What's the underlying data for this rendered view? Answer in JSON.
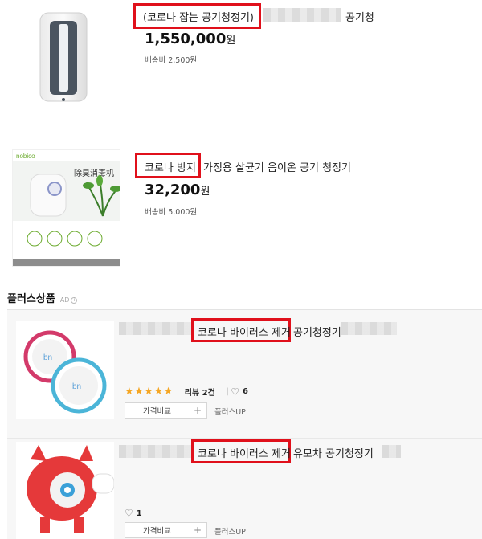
{
  "products": [
    {
      "title_highlight": "(코로나 잡는 공기청정기)",
      "title_suffix": "공기청",
      "price": "1,550,000",
      "currency": "원",
      "shipping": "배송비 2,500원"
    },
    {
      "title_highlight": "코로나 방지",
      "title_suffix": "가정용 살균기 음이온 공기 청정기",
      "price": "32,200",
      "currency": "원",
      "shipping": "배송비 5,000원",
      "image_brand": "nobico",
      "image_caption": "除臭消毒机"
    }
  ],
  "plus_section": {
    "heading": "플러스상품",
    "ad_label": "AD",
    "items": [
      {
        "title_highlight": "코로나 바이러스 제거",
        "title_suffix": "공기청정기",
        "rating_stars": "★★★★★",
        "review_label": "리뷰",
        "review_count": "2건",
        "like_count": "6",
        "compare_label": "가격비교",
        "plusup_label": "플러스UP"
      },
      {
        "title_highlight": "코로나 바이러스 제거",
        "title_suffix": "유모차 공기청정기",
        "like_count": "1",
        "compare_label": "가격비교",
        "plusup_label": "플러스UP"
      }
    ]
  },
  "colors": {
    "highlight_border": "#e0101b",
    "star": "#f5a623",
    "plus_bg": "#f7f7f7"
  }
}
